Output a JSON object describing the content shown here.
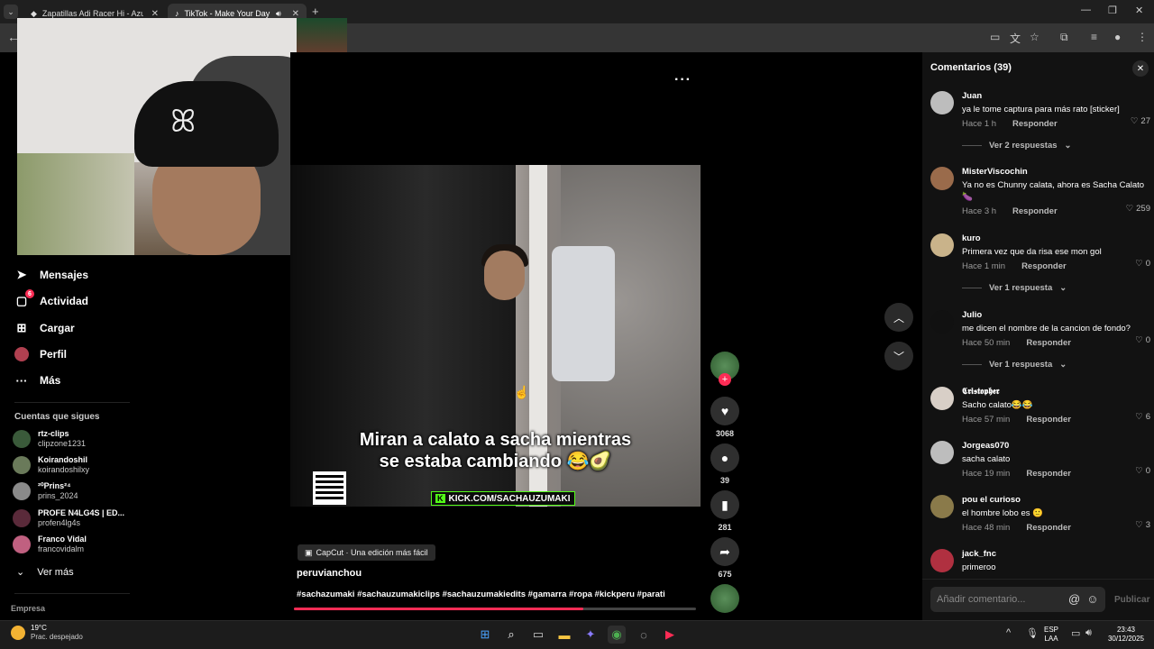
{
  "browser": {
    "tabs": [
      {
        "title": "Zapatillas Adi Racer Hi - Azul ad"
      },
      {
        "title": "TikTok - Make Your Day"
      }
    ]
  },
  "sidebar": {
    "nav": [
      {
        "label": "Mensajes",
        "icon": "send-icon"
      },
      {
        "label": "Actividad",
        "icon": "inbox-icon",
        "badge": "6"
      },
      {
        "label": "Cargar",
        "icon": "upload-icon"
      },
      {
        "label": "Perfil",
        "icon": "avatar"
      },
      {
        "label": "Más",
        "icon": "more-icon"
      }
    ],
    "following_title": "Cuentas que sigues",
    "following": [
      {
        "name": "rtz-clips",
        "username": "clipzone1231",
        "color": "#3a5a3a"
      },
      {
        "name": "Koirandoshil",
        "username": "koirandoshilxy",
        "color": "#6a7a5a"
      },
      {
        "name": "²⁰Prins²⁴",
        "username": "prins_2024",
        "color": "#8a8a8a"
      },
      {
        "name": "PROFE N4LG4S | ED...",
        "username": "profen4lg4s",
        "color": "#5a2a3a"
      },
      {
        "name": "Franco Vidal",
        "username": "francovidalm",
        "color": "#c06080"
      }
    ],
    "see_more": "Ver más",
    "company": "Empresa"
  },
  "video": {
    "caption_line1": "Miran a calato a sacha mientras",
    "caption_line2": "se estaba cambiando 😂🥑",
    "kick_text": "KICK.COM/SACHAUZUMAKI",
    "capcut": "CapCut · Una edición más fácil",
    "author": "peruvianchou",
    "tags": "#sachazumaki #sachauzumakiclips #sachauzumakiedits #gamarra #ropa #kickperu #parati",
    "progress": 0.72,
    "likes": "3068",
    "comments": "39",
    "saves": "281",
    "shares": "675"
  },
  "comments_panel": {
    "title": "Comentarios (39)",
    "input_placeholder": "Añadir comentario...",
    "publish_label": "Publicar",
    "reply_label": "Responder",
    "comments": [
      {
        "user": "Juan",
        "text": "ya le tome captura para más rato [sticker]",
        "time": "Hace 1 h",
        "likes": "27",
        "replies": "Ver 2 respuestas",
        "color": "#bdbdbd"
      },
      {
        "user": "MisterViscochin",
        "text": "Ya no es Chunny calata, ahora es Sacha Calato 🍆",
        "time": "Hace 3 h",
        "likes": "259",
        "replies": "",
        "color": "#9a6b4b"
      },
      {
        "user": "kuro",
        "text": "Primera vez que da risa ese mon gol",
        "time": "Hace 1 min",
        "likes": "0",
        "replies": "Ver 1 respuesta",
        "color": "#c9b38a"
      },
      {
        "user": "Julio",
        "text": "me dicen el nombre de la cancion de fondo?",
        "time": "Hace 50 min",
        "likes": "0",
        "replies": "Ver 1 respuesta",
        "color": "#111111"
      },
      {
        "user": "𝕮𝖗𝖎𝖘𝖙𝖔𝖕𝖍𝖊𝖗",
        "text": "Sacho calato😂😂",
        "time": "Hace 57 min",
        "likes": "6",
        "replies": "",
        "color": "#d8cfc7"
      },
      {
        "user": "Jorgeas070",
        "text": "sacha calato",
        "time": "Hace 19 min",
        "likes": "0",
        "replies": "",
        "color": "#bdbdbd"
      },
      {
        "user": "pou el curioso",
        "text": "el hombre lobo es 🙂",
        "time": "Hace 48 min",
        "likes": "3",
        "replies": "",
        "color": "#8a7a4a"
      },
      {
        "user": "jack_fnc",
        "text": "primeroo",
        "time": "",
        "likes": "",
        "replies": "",
        "color": "#b03040"
      }
    ]
  },
  "taskbar": {
    "temp": "19°C",
    "weather": "Prac. despejado",
    "lang1": "ESP",
    "lang2": "LAA",
    "time": "23:43",
    "date": "30/12/2025"
  }
}
